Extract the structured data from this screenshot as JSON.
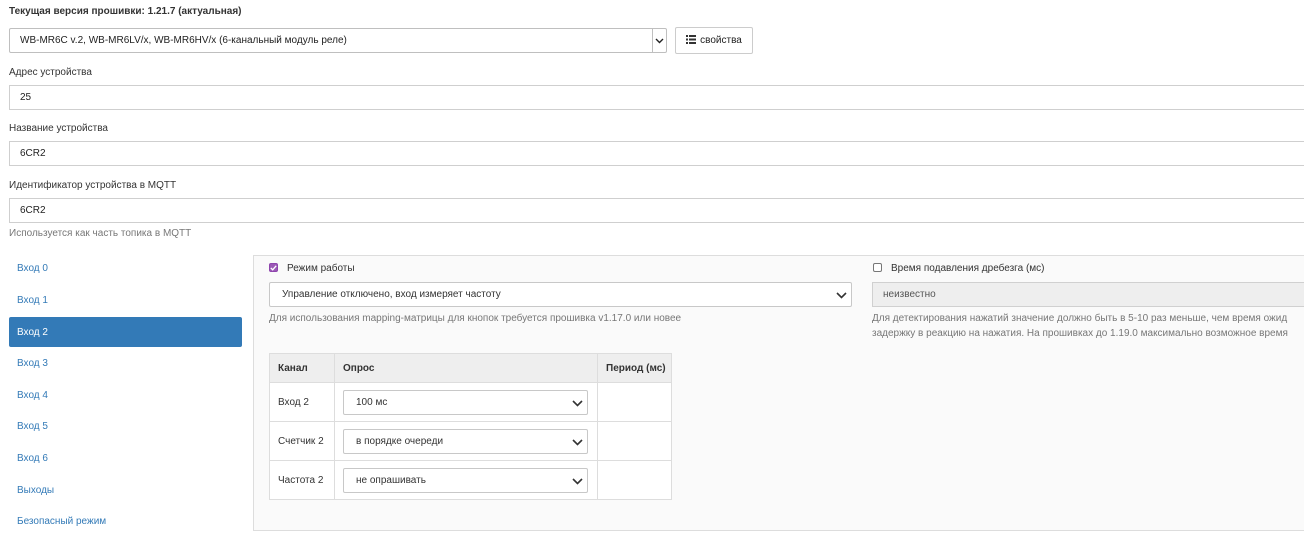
{
  "firmware": {
    "title": "Текущая версия прошивки: 1.21.7 (актуальная)"
  },
  "device_type": {
    "selected": "WB-MR6C v.2, WB-MR6LV/x, WB-MR6HV/x (6-канальный модуль реле)",
    "properties_button": "свойства"
  },
  "fields": {
    "address_label": "Адрес устройства",
    "address_value": "25",
    "name_label": "Название устройства",
    "name_value": "6CR2",
    "mqtt_label": "Идентификатор устройства в MQTT",
    "mqtt_value": "6CR2",
    "mqtt_help": "Используется как часть топика в MQTT"
  },
  "sidebar": {
    "items": [
      {
        "label": "Вход 0"
      },
      {
        "label": "Вход 1"
      },
      {
        "label": "Вход 2"
      },
      {
        "label": "Вход 3"
      },
      {
        "label": "Вход 4"
      },
      {
        "label": "Вход 5"
      },
      {
        "label": "Вход 6"
      },
      {
        "label": "Выходы"
      },
      {
        "label": "Безопасный режим"
      }
    ],
    "active_index": 2
  },
  "panel": {
    "mode_label": "Режим работы",
    "mode_checked": true,
    "mode_value": "Управление отключено, вход измеряет частоту",
    "mode_help": "Для использования mapping-матрицы для кнопок требуется прошивка v1.17.0 или новее",
    "debounce_label": "Время подавления дребезга (мс)",
    "debounce_checked": false,
    "debounce_value": "неизвестно",
    "debounce_help_line1": "Для детектирования нажатий значение должно быть в 5-10 раз меньше, чем время ожид",
    "debounce_help_line2": "задержку в реакцию на нажатия. На прошивках до 1.19.0 максимально возможное время"
  },
  "poll_table": {
    "headers": {
      "channel": "Канал",
      "poll": "Опрос",
      "period": "Период (мс)"
    },
    "rows": [
      {
        "channel": "Вход 2",
        "poll": "100 мс",
        "period": ""
      },
      {
        "channel": "Счетчик 2",
        "poll": "в порядке очереди",
        "period": ""
      },
      {
        "channel": "Частота 2",
        "poll": "не опрашивать",
        "period": ""
      }
    ]
  },
  "colors": {
    "accent": "#337ab7",
    "checkbox": "#9b59b6"
  }
}
